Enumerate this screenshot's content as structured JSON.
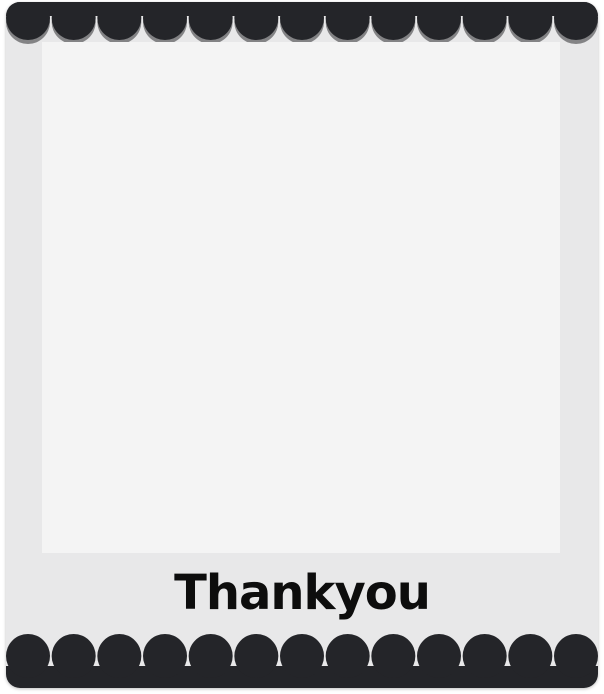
{
  "frame": {
    "caption": "Thankyou",
    "colors": {
      "card_background": "#e8e8e9",
      "photo_placeholder": "#f4f4f4",
      "scallop": "#242529",
      "scallop_shadow": "#838385",
      "caption_text": "#0d0d0d"
    },
    "scallop_count_per_edge": 13
  }
}
